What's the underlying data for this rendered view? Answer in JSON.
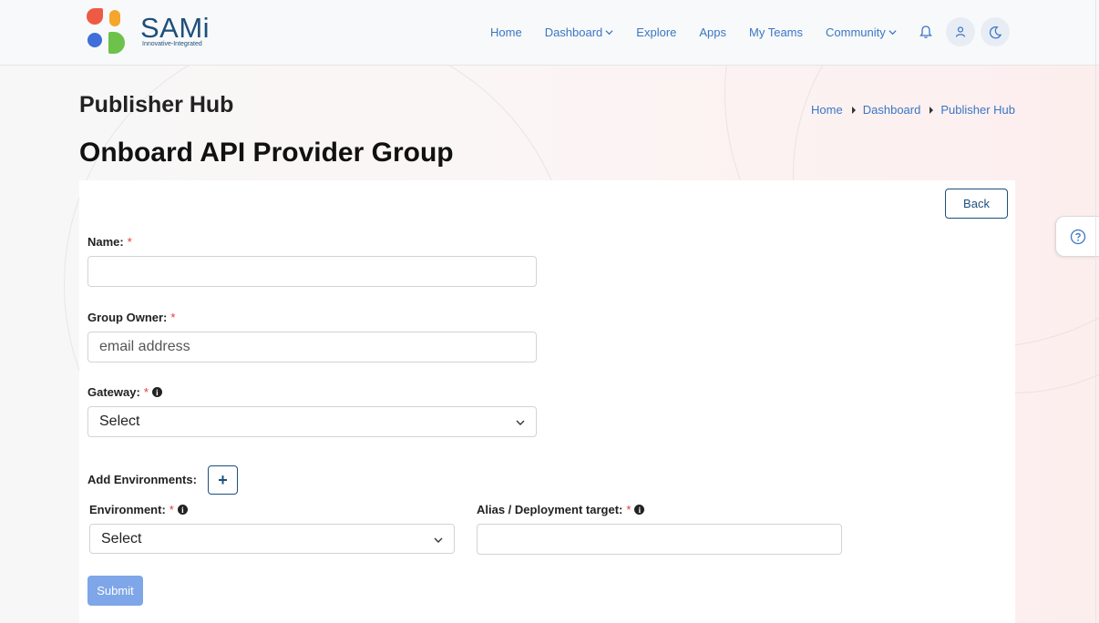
{
  "brand": {
    "name": "SAMi",
    "tagline": "Innovative-Integrated"
  },
  "nav": {
    "items": [
      {
        "label": "Home"
      },
      {
        "label": "Dashboard"
      },
      {
        "label": "Explore"
      },
      {
        "label": "Apps"
      },
      {
        "label": "My Teams"
      },
      {
        "label": "Community"
      }
    ]
  },
  "page": {
    "title": "Publisher Hub",
    "breadcrumb": [
      "Home",
      "Dashboard",
      "Publisher Hub"
    ],
    "form_title": "Onboard API Provider Group"
  },
  "form": {
    "back_label": "Back",
    "name_label": "Name:",
    "name_value": "",
    "owner_label": "Group Owner:",
    "owner_placeholder": "email address",
    "gateway_label": "Gateway:",
    "gateway_value": "Select",
    "add_env_label": "Add Environments:",
    "add_icon": "+",
    "environment_label": "Environment:",
    "environment_value": "Select",
    "alias_label": "Alias / Deployment target:",
    "alias_value": "",
    "required_mark": "*",
    "info_mark": "i",
    "submit_label": "Submit"
  },
  "colors": {
    "accent": "#3a76c4",
    "brand": "#1d4f7c",
    "required": "#e53935",
    "submit": "#7ea6e8"
  }
}
